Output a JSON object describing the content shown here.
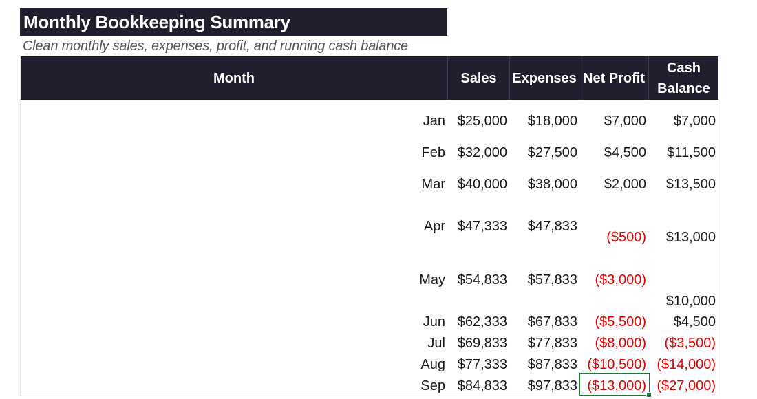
{
  "title": "Monthly Bookkeeping Summary",
  "subtitle": "Clean monthly sales, expenses, profit, and running cash balance",
  "headers": {
    "month": "Month",
    "sales": "Sales",
    "expenses": "Expenses",
    "net_profit": "Net Profit",
    "cash_line1": "Cash",
    "cash_line2": "Balance"
  },
  "rows": [
    {
      "month": "Jan",
      "sales": "$25,000",
      "expenses": "$18,000",
      "net_profit": "$7,000",
      "cash_balance": "$7,000",
      "np_negative": false,
      "cb_negative": false
    },
    {
      "month": "Feb",
      "sales": "$32,000",
      "expenses": "$27,500",
      "net_profit": "$4,500",
      "cash_balance": "$11,500",
      "np_negative": false,
      "cb_negative": false
    },
    {
      "month": "Mar",
      "sales": "$40,000",
      "expenses": "$38,000",
      "net_profit": "$2,000",
      "cash_balance": "$13,500",
      "np_negative": false,
      "cb_negative": false
    },
    {
      "month": "Apr",
      "sales": "$47,333",
      "expenses": "$47,833",
      "net_profit": "($500)",
      "cash_balance": "$13,000",
      "np_negative": true,
      "cb_negative": false
    },
    {
      "month": "May",
      "sales": "$54,833",
      "expenses": "$57,833",
      "net_profit": "($3,000)",
      "cash_balance": "$10,000",
      "np_negative": true,
      "cb_negative": false
    },
    {
      "month": "Jun",
      "sales": "$62,333",
      "expenses": "$67,833",
      "net_profit": "($5,500)",
      "cash_balance": "$4,500",
      "np_negative": true,
      "cb_negative": false
    },
    {
      "month": "Jul",
      "sales": "$69,833",
      "expenses": "$77,833",
      "net_profit": "($8,000)",
      "cash_balance": "($3,500)",
      "np_negative": true,
      "cb_negative": true
    },
    {
      "month": "Aug",
      "sales": "$77,333",
      "expenses": "$87,833",
      "net_profit": "($10,500)",
      "cash_balance": "($14,000)",
      "np_negative": true,
      "cb_negative": true
    },
    {
      "month": "Sep",
      "sales": "$84,833",
      "expenses": "$97,833",
      "net_profit": "($13,000)",
      "cash_balance": "($27,000)",
      "np_negative": true,
      "cb_negative": true
    }
  ],
  "colors": {
    "header_bg": "#1f1f2e",
    "negative": "#e00000",
    "selection": "#1e7a3a"
  }
}
